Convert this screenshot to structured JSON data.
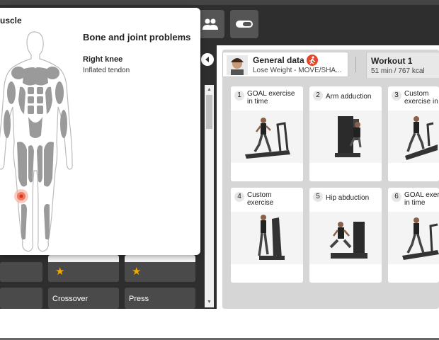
{
  "popup": {
    "title": "uscle",
    "problem_heading": "Bone and joint problems",
    "problem_location": "Right knee",
    "problem_description": "Inflated tendon"
  },
  "grid_cards": [
    {
      "label": ""
    },
    {
      "label": "",
      "starred": true
    },
    {
      "label": "",
      "starred": true
    },
    {
      "label": ""
    },
    {
      "label": "Crossover"
    },
    {
      "label": "Press"
    }
  ],
  "tabs": {
    "general": {
      "title": "General data",
      "subtitle": "Lose Weight - MOVE/SHA..."
    },
    "workout": {
      "title": "Workout 1",
      "subtitle": "51 min / 767 kcal"
    }
  },
  "exercises": [
    {
      "number": "1",
      "label_lines": [
        "GOAL exercise",
        "in time"
      ],
      "icon": "treadmill-runner-icon"
    },
    {
      "number": "2",
      "label_lines": [
        "Arm adduction"
      ],
      "icon": "arm-adduction-machine-icon"
    },
    {
      "number": "3",
      "label_lines": [
        "Custom",
        "exercise in"
      ],
      "icon": "elliptical-trainer-icon"
    },
    {
      "number": "4",
      "label_lines": [
        "Custom",
        "exercise"
      ],
      "icon": "stair-climber-icon"
    },
    {
      "number": "5",
      "label_lines": [
        "Hip abduction"
      ],
      "icon": "hip-abduction-machine-icon"
    },
    {
      "number": "6",
      "label_lines": [
        "GOAL exer",
        "in time"
      ],
      "icon": "treadmill-runner-icon"
    }
  ],
  "colors": {
    "accent": "#e8442a",
    "star": "#f2a900",
    "dark": "#2e2e2e"
  }
}
